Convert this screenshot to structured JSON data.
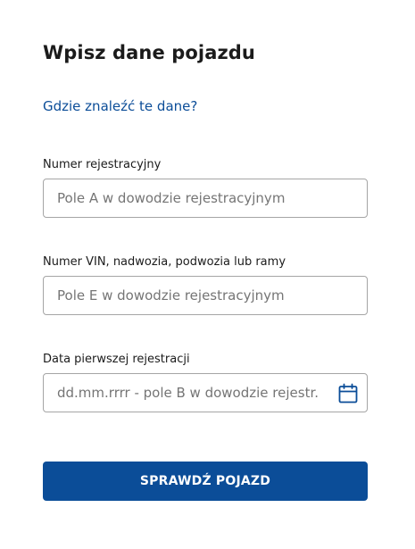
{
  "form": {
    "title": "Wpisz dane pojazdu",
    "help_link": "Gdzie znaleźć te dane?",
    "fields": [
      {
        "label": "Numer rejestracyjny",
        "value": "",
        "placeholder": "Pole A w dowodzie rejestracyjnym"
      },
      {
        "label": "Numer VIN, nadwozia, podwozia lub ramy",
        "value": "",
        "placeholder": "Pole E w dowodzie rejestracyjnym"
      },
      {
        "label": "Data pierwszej rejestracji",
        "value": "",
        "placeholder": "dd.mm.rrrr - pole B w dowodzie rejestr.",
        "icon": "calendar-icon"
      }
    ],
    "submit_label": "SPRAWDŹ POJAZD"
  },
  "colors": {
    "accent": "#0b4d98",
    "text": "#1b1b1b",
    "border": "#a5a5a5",
    "placeholder": "#757575"
  }
}
